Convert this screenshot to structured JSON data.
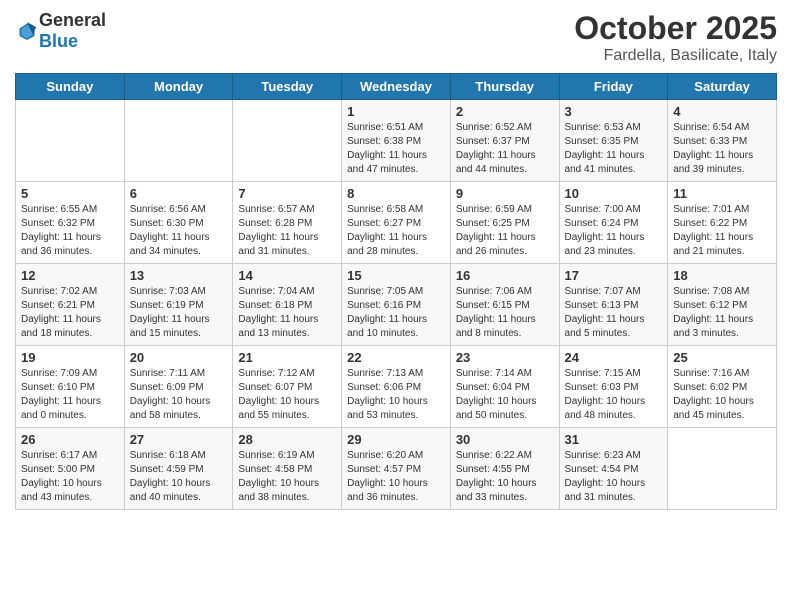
{
  "header": {
    "logo_general": "General",
    "logo_blue": "Blue",
    "title": "October 2025",
    "subtitle": "Fardella, Basilicate, Italy"
  },
  "weekdays": [
    "Sunday",
    "Monday",
    "Tuesday",
    "Wednesday",
    "Thursday",
    "Friday",
    "Saturday"
  ],
  "weeks": [
    [
      {
        "day": "",
        "info": ""
      },
      {
        "day": "",
        "info": ""
      },
      {
        "day": "",
        "info": ""
      },
      {
        "day": "1",
        "info": "Sunrise: 6:51 AM\nSunset: 6:38 PM\nDaylight: 11 hours\nand 47 minutes."
      },
      {
        "day": "2",
        "info": "Sunrise: 6:52 AM\nSunset: 6:37 PM\nDaylight: 11 hours\nand 44 minutes."
      },
      {
        "day": "3",
        "info": "Sunrise: 6:53 AM\nSunset: 6:35 PM\nDaylight: 11 hours\nand 41 minutes."
      },
      {
        "day": "4",
        "info": "Sunrise: 6:54 AM\nSunset: 6:33 PM\nDaylight: 11 hours\nand 39 minutes."
      }
    ],
    [
      {
        "day": "5",
        "info": "Sunrise: 6:55 AM\nSunset: 6:32 PM\nDaylight: 11 hours\nand 36 minutes."
      },
      {
        "day": "6",
        "info": "Sunrise: 6:56 AM\nSunset: 6:30 PM\nDaylight: 11 hours\nand 34 minutes."
      },
      {
        "day": "7",
        "info": "Sunrise: 6:57 AM\nSunset: 6:28 PM\nDaylight: 11 hours\nand 31 minutes."
      },
      {
        "day": "8",
        "info": "Sunrise: 6:58 AM\nSunset: 6:27 PM\nDaylight: 11 hours\nand 28 minutes."
      },
      {
        "day": "9",
        "info": "Sunrise: 6:59 AM\nSunset: 6:25 PM\nDaylight: 11 hours\nand 26 minutes."
      },
      {
        "day": "10",
        "info": "Sunrise: 7:00 AM\nSunset: 6:24 PM\nDaylight: 11 hours\nand 23 minutes."
      },
      {
        "day": "11",
        "info": "Sunrise: 7:01 AM\nSunset: 6:22 PM\nDaylight: 11 hours\nand 21 minutes."
      }
    ],
    [
      {
        "day": "12",
        "info": "Sunrise: 7:02 AM\nSunset: 6:21 PM\nDaylight: 11 hours\nand 18 minutes."
      },
      {
        "day": "13",
        "info": "Sunrise: 7:03 AM\nSunset: 6:19 PM\nDaylight: 11 hours\nand 15 minutes."
      },
      {
        "day": "14",
        "info": "Sunrise: 7:04 AM\nSunset: 6:18 PM\nDaylight: 11 hours\nand 13 minutes."
      },
      {
        "day": "15",
        "info": "Sunrise: 7:05 AM\nSunset: 6:16 PM\nDaylight: 11 hours\nand 10 minutes."
      },
      {
        "day": "16",
        "info": "Sunrise: 7:06 AM\nSunset: 6:15 PM\nDaylight: 11 hours\nand 8 minutes."
      },
      {
        "day": "17",
        "info": "Sunrise: 7:07 AM\nSunset: 6:13 PM\nDaylight: 11 hours\nand 5 minutes."
      },
      {
        "day": "18",
        "info": "Sunrise: 7:08 AM\nSunset: 6:12 PM\nDaylight: 11 hours\nand 3 minutes."
      }
    ],
    [
      {
        "day": "19",
        "info": "Sunrise: 7:09 AM\nSunset: 6:10 PM\nDaylight: 11 hours\nand 0 minutes."
      },
      {
        "day": "20",
        "info": "Sunrise: 7:11 AM\nSunset: 6:09 PM\nDaylight: 10 hours\nand 58 minutes."
      },
      {
        "day": "21",
        "info": "Sunrise: 7:12 AM\nSunset: 6:07 PM\nDaylight: 10 hours\nand 55 minutes."
      },
      {
        "day": "22",
        "info": "Sunrise: 7:13 AM\nSunset: 6:06 PM\nDaylight: 10 hours\nand 53 minutes."
      },
      {
        "day": "23",
        "info": "Sunrise: 7:14 AM\nSunset: 6:04 PM\nDaylight: 10 hours\nand 50 minutes."
      },
      {
        "day": "24",
        "info": "Sunrise: 7:15 AM\nSunset: 6:03 PM\nDaylight: 10 hours\nand 48 minutes."
      },
      {
        "day": "25",
        "info": "Sunrise: 7:16 AM\nSunset: 6:02 PM\nDaylight: 10 hours\nand 45 minutes."
      }
    ],
    [
      {
        "day": "26",
        "info": "Sunrise: 6:17 AM\nSunset: 5:00 PM\nDaylight: 10 hours\nand 43 minutes."
      },
      {
        "day": "27",
        "info": "Sunrise: 6:18 AM\nSunset: 4:59 PM\nDaylight: 10 hours\nand 40 minutes."
      },
      {
        "day": "28",
        "info": "Sunrise: 6:19 AM\nSunset: 4:58 PM\nDaylight: 10 hours\nand 38 minutes."
      },
      {
        "day": "29",
        "info": "Sunrise: 6:20 AM\nSunset: 4:57 PM\nDaylight: 10 hours\nand 36 minutes."
      },
      {
        "day": "30",
        "info": "Sunrise: 6:22 AM\nSunset: 4:55 PM\nDaylight: 10 hours\nand 33 minutes."
      },
      {
        "day": "31",
        "info": "Sunrise: 6:23 AM\nSunset: 4:54 PM\nDaylight: 10 hours\nand 31 minutes."
      },
      {
        "day": "",
        "info": ""
      }
    ]
  ]
}
